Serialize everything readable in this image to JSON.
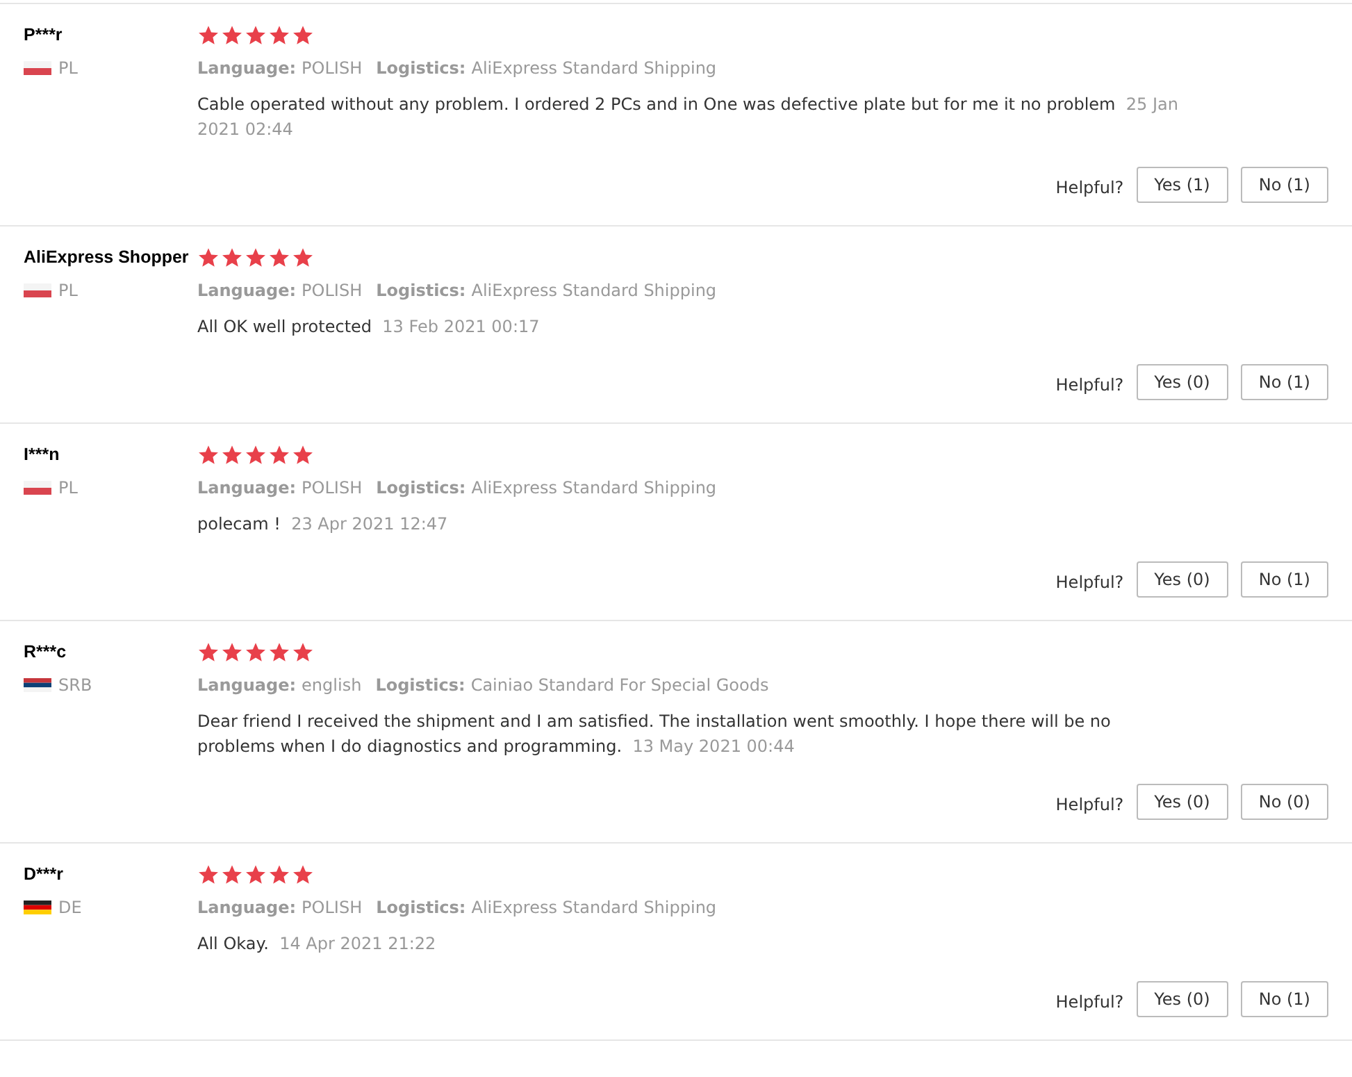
{
  "reviews": [
    {
      "name": "P***r",
      "flag": {
        "kind": "pl"
      },
      "country": "PL",
      "stars": 5,
      "language_label": "Language:",
      "language": "POLISH",
      "logistics_label": "Logistics:",
      "logistics": "AliExpress Standard Shipping",
      "text": "Cable operated without any problem. I ordered 2 PCs and in One was defective plate but for me it no problem",
      "date": "25 Jan 2021 02:44",
      "helpful": "Helpful?",
      "yes": "Yes (1)",
      "no": "No (1)"
    },
    {
      "name": "AliExpress Shopper",
      "flag": {
        "kind": "pl"
      },
      "country": "PL",
      "stars": 5,
      "language_label": "Language:",
      "language": "POLISH",
      "logistics_label": "Logistics:",
      "logistics": "AliExpress Standard Shipping",
      "text": "All OK well protected",
      "date": "13 Feb 2021 00:17",
      "helpful": "Helpful?",
      "yes": "Yes (0)",
      "no": "No (1)"
    },
    {
      "name": "I***n",
      "flag": {
        "kind": "pl"
      },
      "country": "PL",
      "stars": 5,
      "language_label": "Language:",
      "language": "POLISH",
      "logistics_label": "Logistics:",
      "logistics": "AliExpress Standard Shipping",
      "text": "polecam !",
      "date": "23 Apr 2021 12:47",
      "helpful": "Helpful?",
      "yes": "Yes (0)",
      "no": "No (1)"
    },
    {
      "name": "R***c",
      "flag": {
        "kind": "rs"
      },
      "country": "SRB",
      "stars": 5,
      "language_label": "Language:",
      "language": "english",
      "logistics_label": "Logistics:",
      "logistics": "Cainiao Standard For Special Goods",
      "text": "Dear friend I received the shipment and I am satisfied. The installation went smoothly. I hope there will be no problems when I do diagnostics and programming.",
      "date": "13 May 2021 00:44",
      "helpful": "Helpful?",
      "yes": "Yes (0)",
      "no": "No (0)"
    },
    {
      "name": "D***r",
      "flag": {
        "kind": "de"
      },
      "country": "DE",
      "stars": 5,
      "language_label": "Language:",
      "language": "POLISH",
      "logistics_label": "Logistics:",
      "logistics": "AliExpress Standard Shipping",
      "text": "All Okay.",
      "date": "14 Apr 2021 21:22",
      "helpful": "Helpful?",
      "yes": "Yes (0)",
      "no": "No (1)"
    }
  ]
}
